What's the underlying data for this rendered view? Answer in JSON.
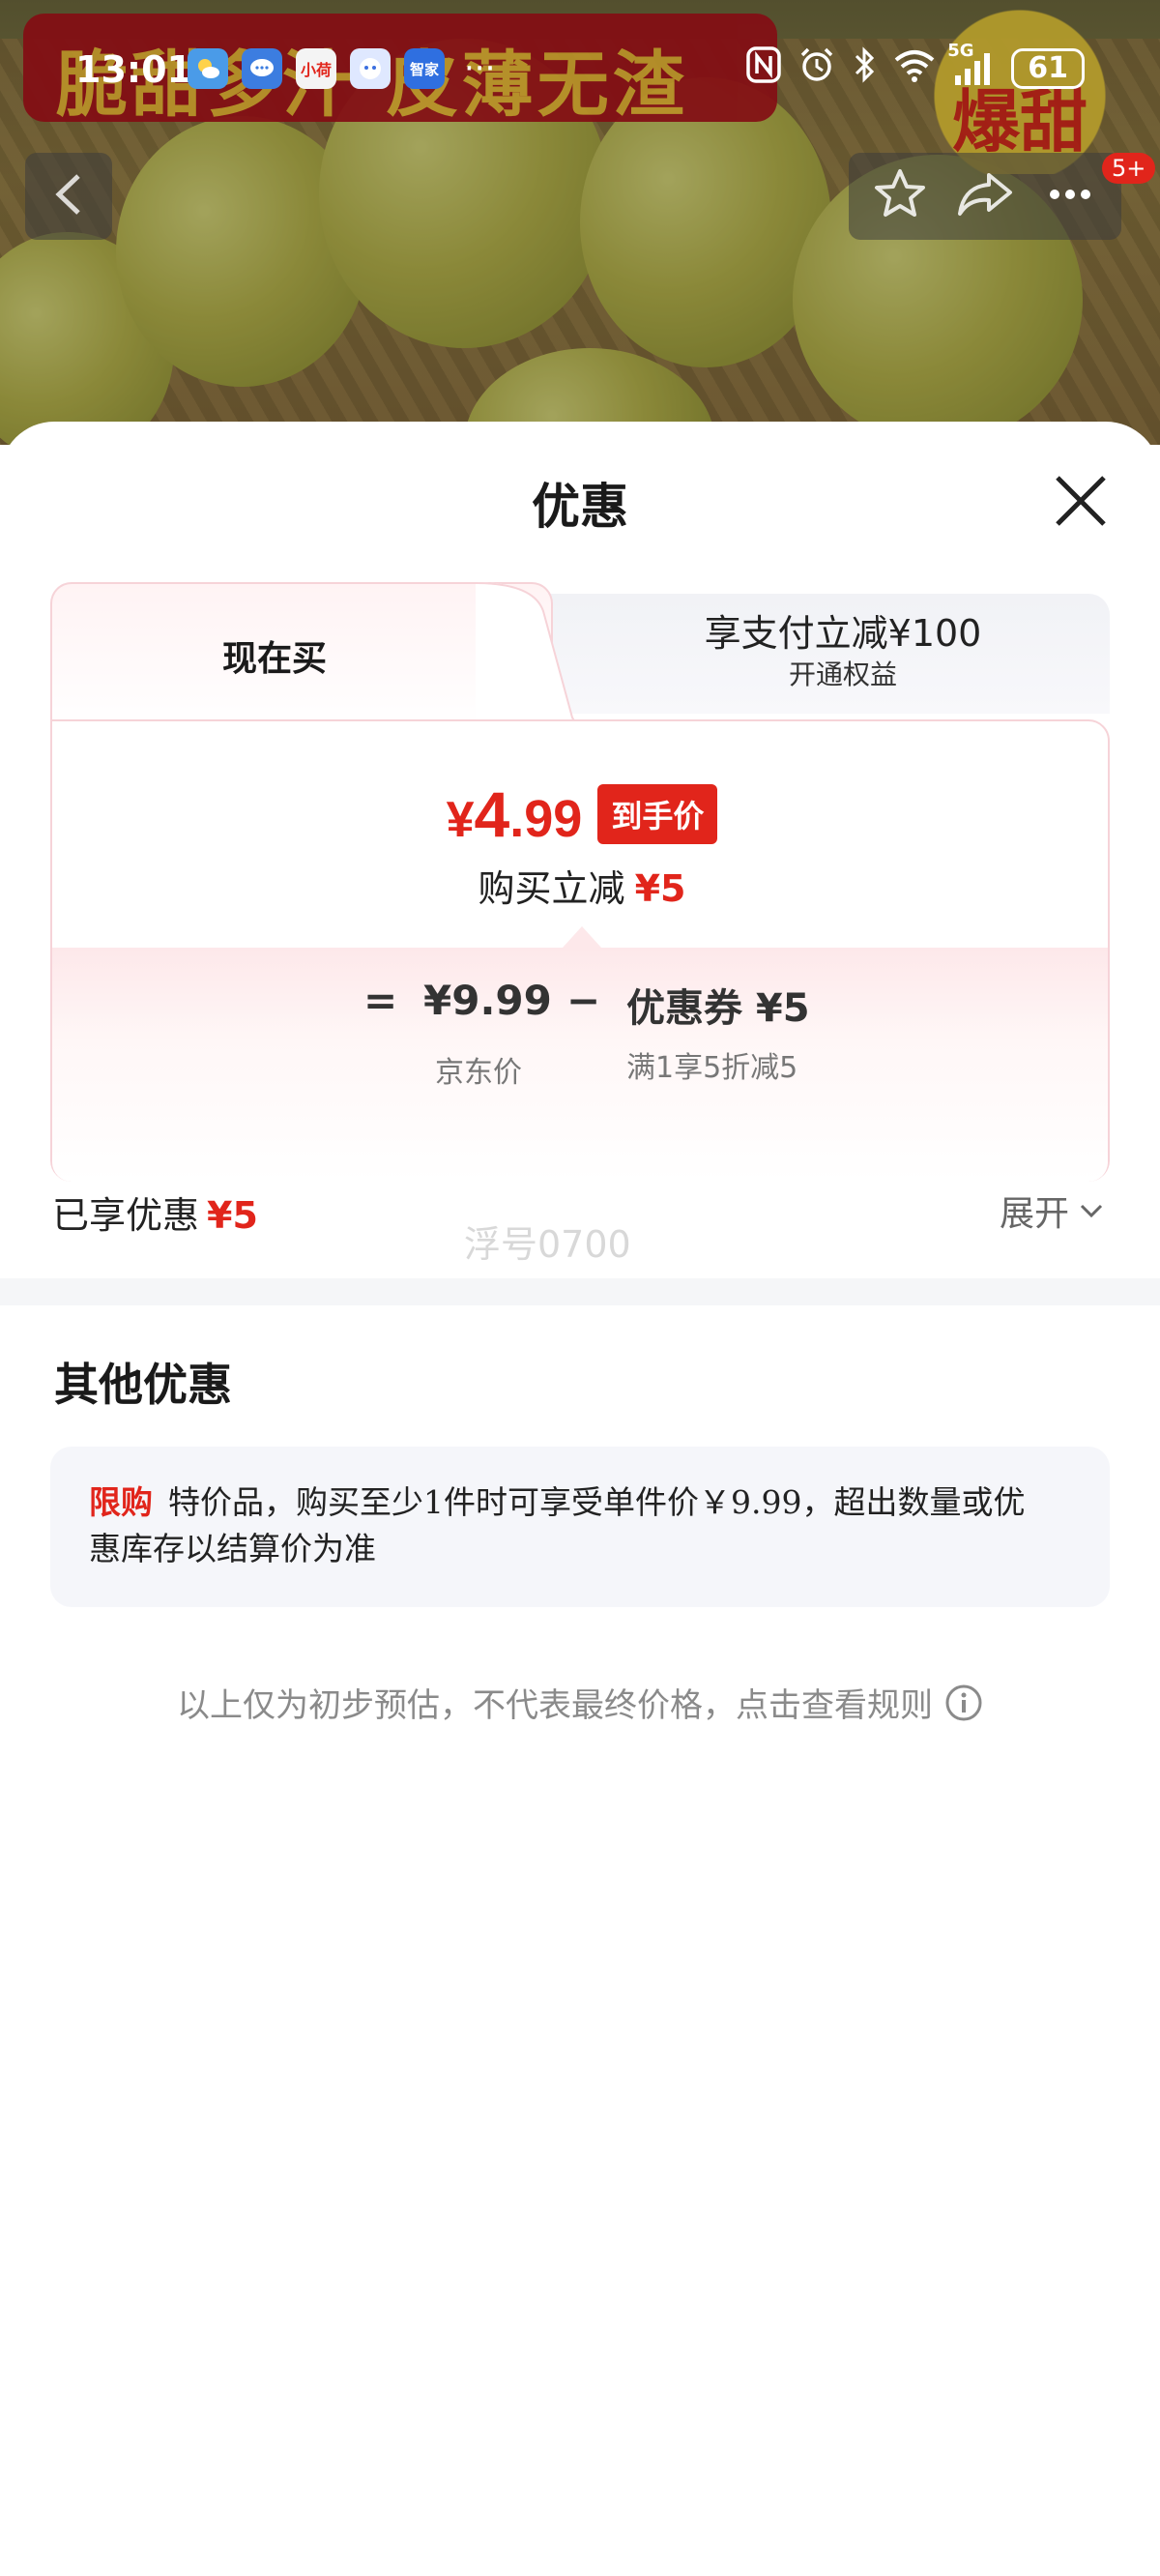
{
  "status_bar": {
    "time": "13:01",
    "app_icons": [
      {
        "name": "weather-icon",
        "label": "",
        "color": "#4a9be8"
      },
      {
        "name": "message-icon",
        "label": "",
        "color": "#3c7de0"
      },
      {
        "name": "xiaohongshu-icon",
        "label": "小荷",
        "color": "#f0f0f0"
      },
      {
        "name": "assistant-icon",
        "label": "",
        "color": "#dfe8ff"
      },
      {
        "name": "smart-home-icon",
        "label": "智家",
        "color": "#2f6fe0"
      }
    ],
    "more": "···",
    "network": "5G",
    "battery": "61"
  },
  "hero": {
    "promo_text": "脆甜多汁 皮薄无渣",
    "star_text": "爆甜",
    "cart_badge": "5+"
  },
  "sheet": {
    "title": "优惠",
    "tabs": {
      "now": "现在买",
      "other_title": "享支付立减¥100",
      "other_sub": "开通权益"
    },
    "final_price": {
      "yen": "¥",
      "integer": "4",
      "decimal": ".99",
      "tag": "到手价"
    },
    "reduce": {
      "label": "购买立减",
      "amount": "¥5"
    },
    "calc": {
      "equals": "=",
      "original_price": "¥9.99",
      "minus": "−",
      "coupon": "优惠券 ¥5",
      "original_label": "京东价",
      "coupon_label": "满1享5折减5"
    },
    "enjoyed": {
      "label": "已享优惠",
      "amount": "¥5"
    },
    "watermark": "浮号0700",
    "expand": "展开",
    "other_title": "其他优惠",
    "rule": {
      "tag": "限购",
      "text": "特价品，购买至少1件时可享受单件价￥9.99，超出数量或优惠库存以结算价为准"
    },
    "footer_note": "以上仅为初步预估，不代表最终价格，点击查看规则"
  },
  "colors": {
    "accent_red": "#e1251b",
    "tab_border": "#f6d3d8",
    "panel_gray": "#f5f6fa"
  }
}
